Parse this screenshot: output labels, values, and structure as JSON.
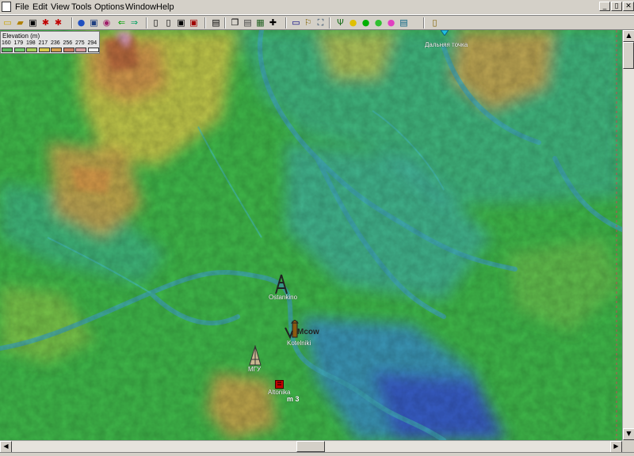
{
  "menubar": {
    "items": [
      "File",
      "Edit",
      "View",
      "Tools",
      "Options",
      "Window",
      "Help"
    ],
    "window_controls": {
      "minimize": "_",
      "restore": "▯",
      "close": "✕"
    }
  },
  "toolbar": {
    "buttons": [
      {
        "name": "new-icon",
        "glyph": "▭",
        "color": "#c8a000"
      },
      {
        "name": "open-folder-icon",
        "glyph": "▰",
        "color": "#b08000"
      },
      {
        "name": "save-icon",
        "glyph": "▣",
        "color": "#000"
      },
      {
        "name": "network-icon",
        "glyph": "✱",
        "color": "#c00000"
      },
      {
        "name": "network-edit-icon",
        "glyph": "✱",
        "color": "#c00000"
      },
      {
        "name": "globe-icon",
        "glyph": "●",
        "color": "#2050c0"
      },
      {
        "name": "disk-globe-icon",
        "glyph": "▣",
        "color": "#204080"
      },
      {
        "name": "record-icon",
        "glyph": "◉",
        "color": "#a0206a"
      },
      {
        "name": "arrow-left-icon",
        "glyph": "⇐",
        "color": "#00a000"
      },
      {
        "name": "arrow-right-icon",
        "glyph": "⇒",
        "color": "#00a060"
      },
      {
        "name": "page-icon",
        "glyph": "▯",
        "color": "#000"
      },
      {
        "name": "page-copy-icon",
        "glyph": "▯",
        "color": "#000"
      },
      {
        "name": "save-as-icon",
        "glyph": "▣",
        "color": "#000"
      },
      {
        "name": "pdf-icon",
        "glyph": "▣",
        "color": "#a00000"
      },
      {
        "name": "print-icon",
        "glyph": "▤",
        "color": "#000"
      },
      {
        "name": "copy-icon",
        "glyph": "❐",
        "color": "#000"
      },
      {
        "name": "clipboard-icon",
        "glyph": "▤",
        "color": "#404040"
      },
      {
        "name": "map-icon",
        "glyph": "▦",
        "color": "#206020"
      },
      {
        "name": "crosshair-icon",
        "glyph": "✚",
        "color": "#000"
      },
      {
        "name": "window-icon",
        "glyph": "▭",
        "color": "#000080"
      },
      {
        "name": "tower-icon",
        "glyph": "⚐",
        "color": "#806000"
      },
      {
        "name": "zoom-extent-icon",
        "glyph": "⛶",
        "color": "#204060"
      },
      {
        "name": "antenna-icon",
        "glyph": "Ψ",
        "color": "#207020"
      },
      {
        "name": "coverage-icon",
        "glyph": "●",
        "color": "#e0c000"
      },
      {
        "name": "green-globe-icon",
        "glyph": "●",
        "color": "#00b000"
      },
      {
        "name": "green-circle-icon",
        "glyph": "●",
        "color": "#30c030"
      },
      {
        "name": "pink-globe-icon",
        "glyph": "●",
        "color": "#e040c0"
      },
      {
        "name": "profile-icon",
        "glyph": "▤",
        "color": "#006080"
      },
      {
        "name": "exit-icon",
        "glyph": "▯",
        "color": "#806000"
      }
    ]
  },
  "legend": {
    "title": "Elevation (m)",
    "values": [
      "160",
      "179",
      "198",
      "217",
      "236",
      "256",
      "275",
      "294"
    ],
    "colors": [
      "#58b85a",
      "#74c96e",
      "#a8cf5a",
      "#d6c84a",
      "#d3a24c",
      "#c98062",
      "#d8a0a0",
      "#eeeeee"
    ]
  },
  "map": {
    "colors": {
      "low": "#3858c8",
      "water": "#4a7fc8",
      "teal": "#3fb3a8",
      "green": "#3fb84a",
      "light_green": "#72c248",
      "yellow": "#c8c450",
      "orange": "#d49a4a",
      "brown": "#b86a3c"
    },
    "markers": [
      {
        "name": "ostankino-tower-icon",
        "label": "Ostankino"
      },
      {
        "name": "kotelniki-icon",
        "label": "Kotelniki"
      },
      {
        "name": "mgu-icon",
        "label": "МГУ"
      },
      {
        "name": "altonika-icon",
        "label": "Altonika"
      },
      {
        "name": "far-point-icon",
        "label": "Дальняя точка"
      }
    ],
    "text_labels": {
      "moscow": "Mcow",
      "m3": "m 3"
    }
  }
}
